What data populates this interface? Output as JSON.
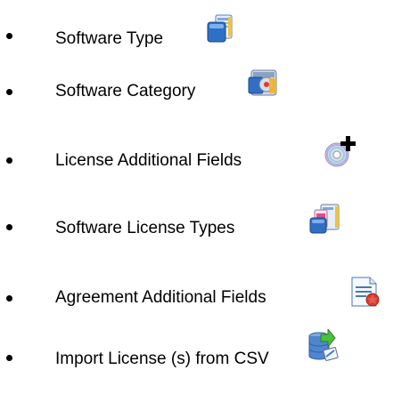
{
  "list": {
    "items": [
      {
        "label": "Software Type",
        "icon": "software-type-icon"
      },
      {
        "label": "Software Category",
        "icon": "software-category-icon"
      },
      {
        "label": "License Additional Fields",
        "icon": "license-additional-fields-icon"
      },
      {
        "label": "Software License Types",
        "icon": "software-license-types-icon"
      },
      {
        "label": "Agreement Additional Fields",
        "icon": "agreement-additional-fields-icon"
      },
      {
        "label": "Import License (s) from CSV",
        "icon": "import-csv-icon"
      }
    ]
  }
}
